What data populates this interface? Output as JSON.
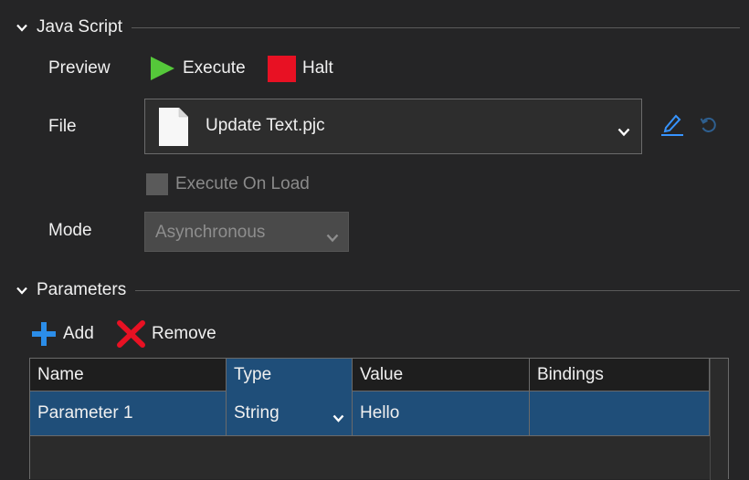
{
  "javascript_section": {
    "title": "Java Script",
    "preview_label": "Preview",
    "execute_label": "Execute",
    "halt_label": "Halt",
    "file_label": "File",
    "file_value": "Update Text.pjc",
    "execute_on_load_label": "Execute On Load",
    "execute_on_load_checked": false,
    "mode_label": "Mode",
    "mode_value": "Asynchronous"
  },
  "parameters_section": {
    "title": "Parameters",
    "add_label": "Add",
    "remove_label": "Remove",
    "columns": [
      "Name",
      "Type",
      "Value",
      "Bindings"
    ],
    "rows": [
      {
        "name": "Parameter 1",
        "type": "String",
        "value": "Hello",
        "bindings": ""
      }
    ]
  },
  "icons": {
    "section_toggle": "chevron-down-icon",
    "execute": "play-icon",
    "halt": "stop-icon",
    "file": "document-icon",
    "dropdown": "chevron-down-icon",
    "edit": "pencil-icon",
    "reset": "undo-icon",
    "add": "plus-icon",
    "remove": "x-icon"
  },
  "colors": {
    "background": "#252526",
    "execute_green": "#55c83a",
    "halt_red": "#e81123",
    "selection_blue": "#1f4e79",
    "add_blue": "#2b8de8",
    "remove_red": "#e81123",
    "edit_blue": "#3794ff"
  }
}
